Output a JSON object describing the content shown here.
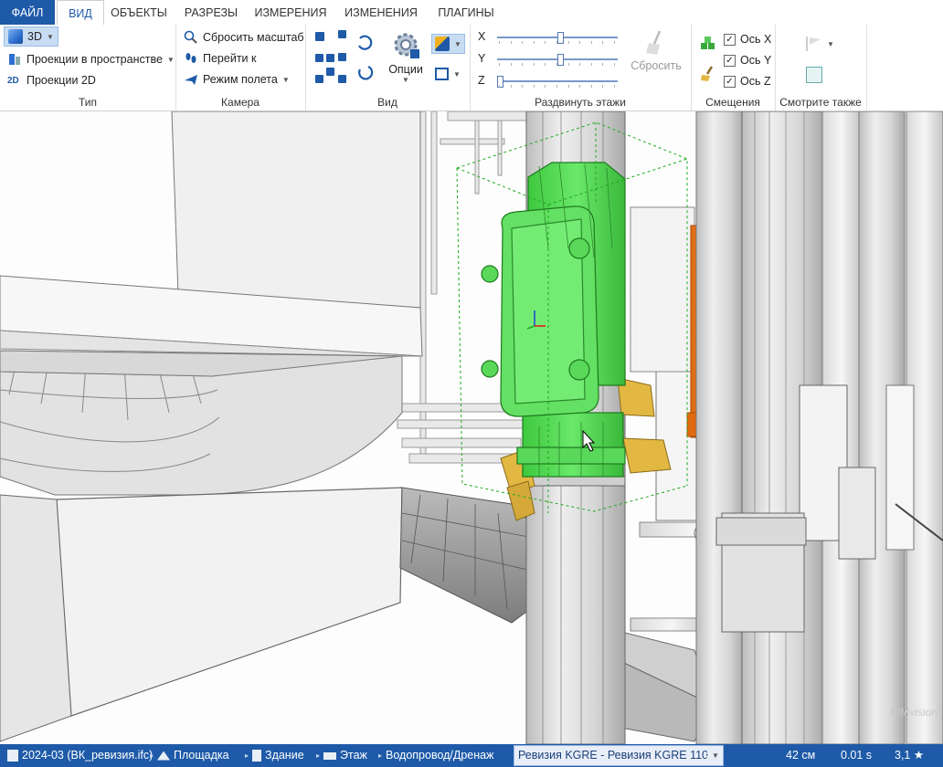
{
  "tabs": {
    "file": "ФАЙЛ",
    "view": "ВИД",
    "objects": "ОБЪЕКТЫ",
    "sections": "РАЗРЕЗЫ",
    "measurements": "ИЗМЕРЕНИЯ",
    "changes": "ИЗМЕНЕНИЯ",
    "plugins": "ПЛАГИНЫ"
  },
  "ribbon": {
    "type_group": {
      "title": "Тип",
      "mode_3d": "3D",
      "space_projections": "Проекции в пространстве",
      "projections_2d": "Проекции 2D",
      "icon_2d": "2D"
    },
    "camera_group": {
      "title": "Камера",
      "reset_scale": "Сбросить масштаб",
      "go_to": "Перейти к",
      "flight_mode": "Режим полета"
    },
    "view_group": {
      "title": "Вид",
      "options": "Опции"
    },
    "spread_group": {
      "title": "Раздвинуть этажи",
      "x_label": "X",
      "y_label": "Y",
      "z_label": "Z",
      "x_value": 0.52,
      "y_value": 0.52,
      "z_value": 0.0,
      "reset": "Сбросить"
    },
    "offsets_group": {
      "title": "Смещения",
      "axis_x": "Ось X",
      "axis_y": "Ось Y",
      "axis_z": "Ось Z"
    },
    "see_also_group": {
      "title": "Смотрите также"
    }
  },
  "statusbar": {
    "file": "2024-03 (ВК_ревизия.ifc)",
    "site": "Площадка",
    "building": "Здание",
    "floor": "Этаж",
    "system": "Водопровод/Дренаж",
    "revision": "Ревизия KGRE - Ревизия KGRE 110",
    "more": ">",
    "distance": "42 см",
    "time": "0.01 s",
    "rating": "3,1 ★"
  },
  "watermark": "BIMvision",
  "colors": {
    "accent": "#1e5aa8",
    "selected": "#5fe05f",
    "orange": "#f07a1a",
    "brass": "#e2b843"
  }
}
